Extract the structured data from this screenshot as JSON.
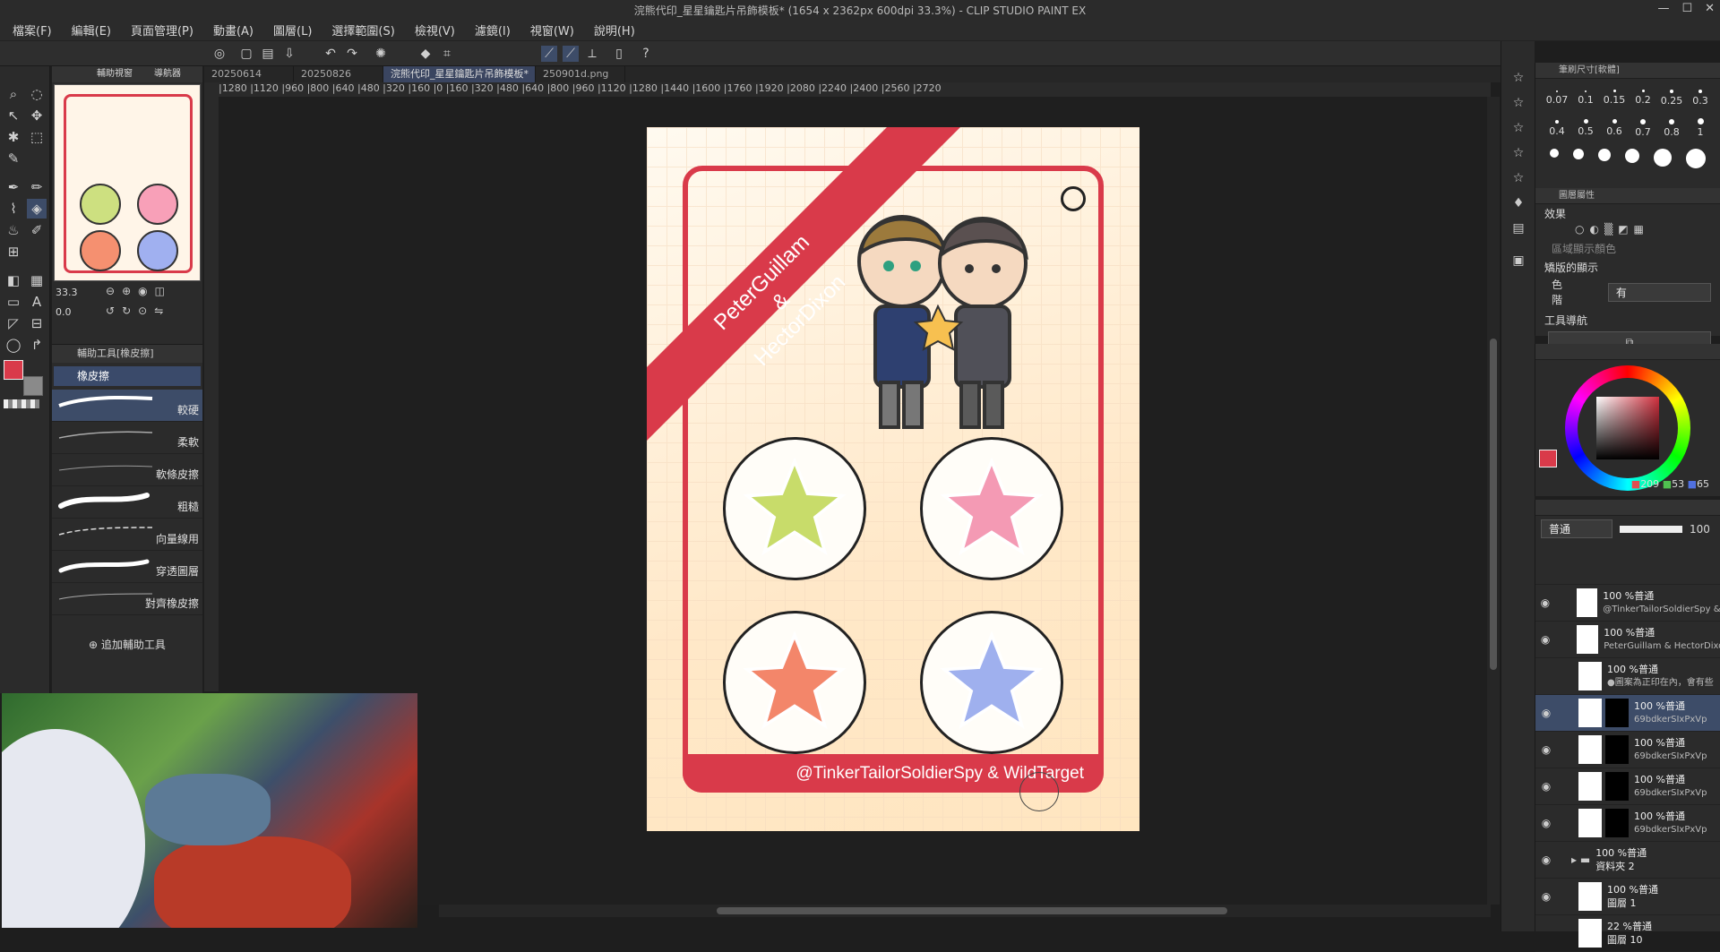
{
  "title": "浣熊代印_星星鑰匙片吊飾模板* (1654 x 2362px 600dpi 33.3%) - CLIP STUDIO PAINT EX",
  "menu": [
    "檔案(F)",
    "編輯(E)",
    "頁面管理(P)",
    "動畫(A)",
    "圖層(L)",
    "選擇範圍(S)",
    "檢視(V)",
    "濾鏡(I)",
    "視窗(W)",
    "說明(H)"
  ],
  "tabs": [
    "20250614",
    "20250826",
    "浣熊代印_星星鑰匙片吊飾模板*",
    "250901d.png"
  ],
  "ruler_top": "|1280 |1120 |960 |800 |640 |480 |320 |160 |0 |160 |320 |480 |640 |800 |960 |1120 |1280 |1440 |1600 |1760 |1920 |2080 |2240 |2400 |2560 |2720",
  "navigator": {
    "tab_a": "輔助視窗",
    "tab_b": "導航器",
    "zoom": "33.3",
    "angle": "0.0"
  },
  "subtool": {
    "header": "輔助工具[橡皮擦]",
    "category": "橡皮擦",
    "items": [
      "較硬",
      "柔軟",
      "軟條皮擦",
      "粗糙",
      "向量線用",
      "穿透圖層",
      "對齊橡皮擦"
    ],
    "add_label": "追加輔助工具"
  },
  "colors": {
    "main": "#d93a4a",
    "sub": "#8a8a8a",
    "accent": "#3d4c68"
  },
  "artwork": {
    "diag_line1": "PeterGuillam",
    "diag_line2": "&",
    "diag_line3": "HectorDixon",
    "footer": "@TinkerTailorSoldierSpy & WildTarget"
  },
  "brush_size": {
    "header": "筆刷尺寸[軟體]",
    "values": [
      "0.07",
      "0.1",
      "0.15",
      "0.2",
      "0.25",
      "0.3",
      "0.4",
      "0.5",
      "0.6",
      "0.7",
      "0.8",
      "1"
    ]
  },
  "layer_props": {
    "header": "圖層屬性",
    "effect": "效果",
    "area_color": "區域顯示顏色",
    "display": "矯版的顯示",
    "color_label": "色階",
    "color_value": "有",
    "tool_nav": "工具導航"
  },
  "color_rgb": {
    "r": "209",
    "g": "53",
    "b": "65"
  },
  "layers_panel": {
    "blend": "普通",
    "opacity": "100"
  },
  "layers": [
    {
      "line1": "100 %普通",
      "line2": "@TinkerTailorSoldierSpy & W"
    },
    {
      "line1": "100 %普通",
      "line2": "PeterGuillam & HectorDixon"
    },
    {
      "line1": "100 %普通",
      "line2": "●圖案為正印在內，會有些"
    },
    {
      "line1": "100 %普通",
      "line2": "69bdkerSIxPxVp"
    },
    {
      "line1": "100 %普通",
      "line2": "69bdkerSIxPxVp"
    },
    {
      "line1": "100 %普通",
      "line2": "69bdkerSIxPxVp"
    },
    {
      "line1": "100 %普通",
      "line2": "69bdkerSIxPxVp"
    },
    {
      "line1": "100 %普通",
      "line2": "資料夾 2"
    },
    {
      "line1": "100 %普通",
      "line2": "圖層 1"
    },
    {
      "line1": "22 %普通",
      "line2": "圖層 10"
    }
  ]
}
